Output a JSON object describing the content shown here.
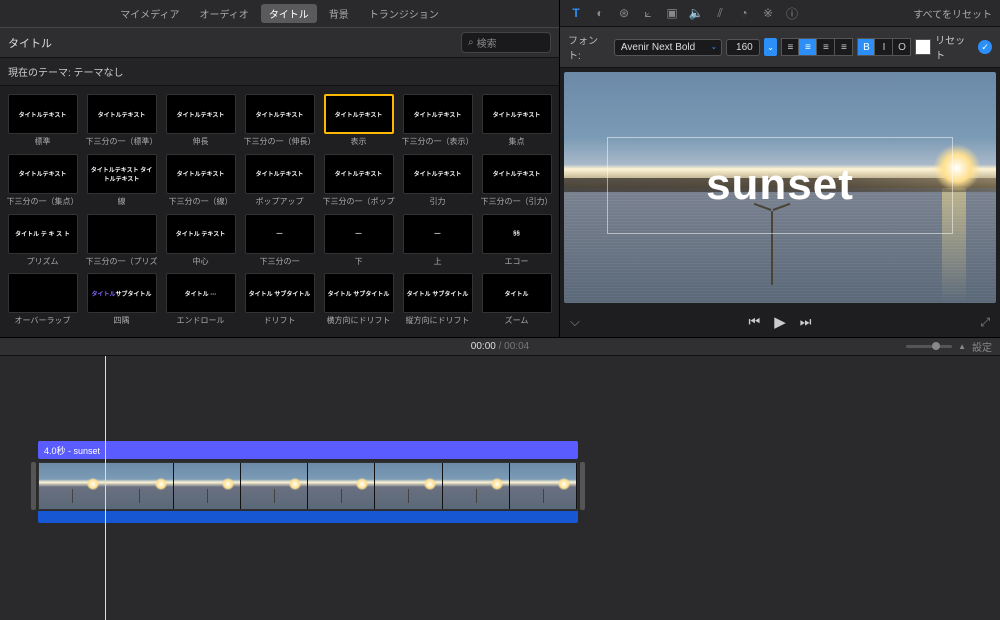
{
  "mediaTabs": {
    "items": [
      "マイメディア",
      "オーディオ",
      "タイトル",
      "背景",
      "トランジション"
    ],
    "activeIndex": 2
  },
  "titlePanel": {
    "headerLabel": "タイトル",
    "searchPlaceholder": "検索",
    "themeLabel": "現在のテーマ: テーマなし"
  },
  "titleGrid": {
    "selectedIndex": 4,
    "items": [
      {
        "label": "標準",
        "thumbText": "タイトルテキスト"
      },
      {
        "label": "下三分の一（標準）",
        "thumbText": "タイトルテキスト"
      },
      {
        "label": "伸長",
        "thumbText": "タイトルテキスト"
      },
      {
        "label": "下三分の一（伸長）",
        "thumbText": "タイトルテキスト"
      },
      {
        "label": "表示",
        "thumbText": "タイトルテキスト"
      },
      {
        "label": "下三分の一（表示）",
        "thumbText": "タイトルテキスト"
      },
      {
        "label": "集点",
        "thumbText": "タイトルテキスト"
      },
      {
        "label": "下三分の一（集点）",
        "thumbText": "タイトルテキスト"
      },
      {
        "label": "線",
        "thumbText": "タイトルテキスト\nタイトルテキスト"
      },
      {
        "label": "下三分の一（線）",
        "thumbText": "タイトルテキスト"
      },
      {
        "label": "ポップアップ",
        "thumbText": "タイトルテキスト"
      },
      {
        "label": "下三分の一（ポップアップ）",
        "thumbText": "タイトルテキスト"
      },
      {
        "label": "引力",
        "thumbText": "タイトルテキスト"
      },
      {
        "label": "下三分の一（引力）",
        "thumbText": "タイトルテキスト"
      },
      {
        "label": "プリズム",
        "thumbText": "タイトル テ キ ス ト"
      },
      {
        "label": "下三分の一（プリズム）",
        "thumbText": ""
      },
      {
        "label": "中心",
        "thumbText": "タイトル\nテキスト"
      },
      {
        "label": "下三分の一",
        "thumbText": "—"
      },
      {
        "label": "下",
        "thumbText": "—"
      },
      {
        "label": "上",
        "thumbText": "—"
      },
      {
        "label": "エコー",
        "thumbText": "§§"
      },
      {
        "label": "オーバーラップ",
        "thumbText": ""
      },
      {
        "label": "四隅",
        "thumbText": "タイトル\nサブタイトル"
      },
      {
        "label": "エンドロール",
        "thumbText": "タイトル\n···"
      },
      {
        "label": "ドリフト",
        "thumbText": "タイトル\nサブタイトル"
      },
      {
        "label": "横方向にドリフト",
        "thumbText": "タイトル\nサブタイトル"
      },
      {
        "label": "縦方向にドリフト",
        "thumbText": "タイトル サブタイトル"
      },
      {
        "label": "ズーム",
        "thumbText": "タイトル"
      }
    ]
  },
  "inspector": {
    "resetAll": "すべてをリセット",
    "fontLabel": "フォント:",
    "fontValue": "Avenir Next Bold",
    "fontSize": "160",
    "bold": "B",
    "italic": "I",
    "outline": "O",
    "resetBtn": "リセット",
    "colorSwatch": "#ffffff"
  },
  "preview": {
    "titleText": "sunset"
  },
  "timeline": {
    "timeCurrent": "00:00",
    "timeTotal": "00:04",
    "settingsLabel": "設定",
    "titleClipLabel": "4.0秒 - sunset",
    "videoFrameCount": 8
  }
}
